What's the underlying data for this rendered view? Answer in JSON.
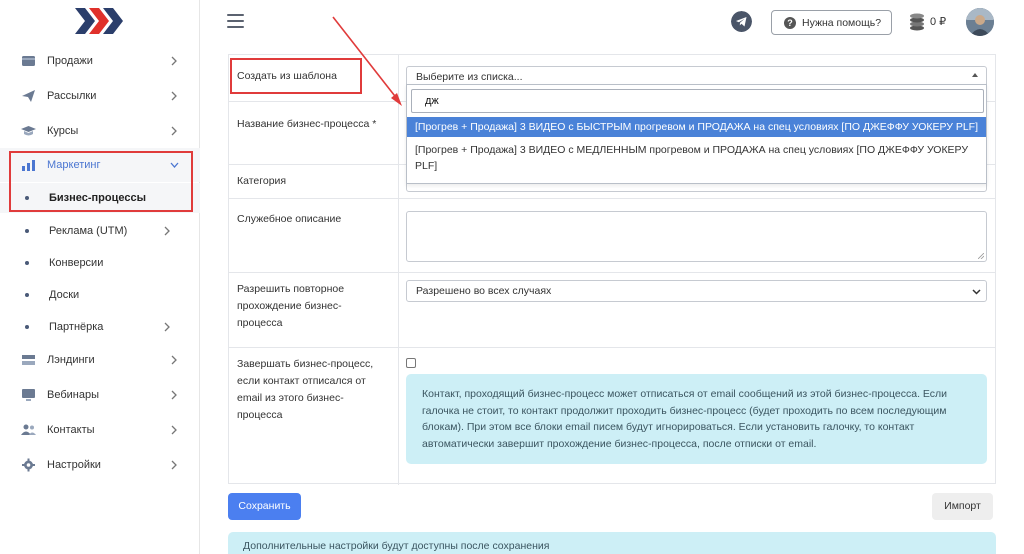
{
  "sidebar": {
    "items": [
      {
        "label": "Продажи",
        "icon": "wallet-icon",
        "has_chevron": true
      },
      {
        "label": "Рассылки",
        "icon": "paper-plane-icon",
        "has_chevron": true
      },
      {
        "label": "Курсы",
        "icon": "graduation-cap-icon",
        "has_chevron": true
      },
      {
        "label": "Маркетинг",
        "icon": "chart-icon",
        "has_chevron": true,
        "active": true,
        "expanded": true
      },
      {
        "label": "Лэндинги",
        "icon": "layers-icon",
        "has_chevron": true
      },
      {
        "label": "Вебинары",
        "icon": "monitor-icon",
        "has_chevron": true
      },
      {
        "label": "Контакты",
        "icon": "users-icon",
        "has_chevron": true
      },
      {
        "label": "Настройки",
        "icon": "gear-icon",
        "has_chevron": true
      }
    ],
    "subitems": [
      {
        "label": "Бизнес-процессы",
        "active": true
      },
      {
        "label": "Реклама (UTM)",
        "has_chevron": true
      },
      {
        "label": "Конверсии"
      },
      {
        "label": "Доски"
      },
      {
        "label": "Партнёрка",
        "has_chevron": true
      }
    ]
  },
  "header": {
    "help_label": "Нужна помощь?",
    "balance": "0 ₽"
  },
  "form": {
    "template": {
      "label": "Создать из шаблона",
      "placeholder": "Выберите из списка...",
      "search_value": "дж",
      "options": [
        "[Прогрев + Продажа] 3 ВИДЕО с БЫСТРЫМ прогревом и ПРОДАЖА на спец условиях [ПО ДЖЕФФУ УОКЕРУ PLF]",
        "[Прогрев + Продажа] 3 ВИДЕО с МЕДЛЕННЫМ прогревом и ПРОДАЖА на спец условиях [ПО ДЖЕФФУ УОКЕРУ PLF]"
      ],
      "highlighted_option": 0
    },
    "name_label": "Название бизнес-процесса *",
    "category_label": "Категория",
    "description_label": "Служебное описание",
    "repeat_label": "Разрешить повторное прохождение бизнес-процесса",
    "repeat_value": "Разрешено во всех случаях",
    "unsubscribe_label": "Завершать бизнес-процесс, если контакт отписался от email из этого бизнес-процесса",
    "unsubscribe_checked": false,
    "unsubscribe_info": "Контакт, проходящий бизнес-процесс может отписаться от email сообщений из этой бизнес-процесса. Если галочка не стоит, то контакт продолжит проходить бизнес-процесс (будет проходить по всем последующим блокам). При этом все блоки email писем будут игнорироваться. Если установить галочку, то контакт автоматически завершит прохождение бизнес-процесса, после отписки от email."
  },
  "actions": {
    "save_label": "Сохранить",
    "import_label": "Импорт"
  },
  "notice": "Дополнительные настройки будут доступны после сохранения",
  "colors": {
    "accent": "#4b7ff0",
    "annotation": "#e03b3b",
    "info_bg": "#cdeff6",
    "highlight": "#4a82d8"
  }
}
